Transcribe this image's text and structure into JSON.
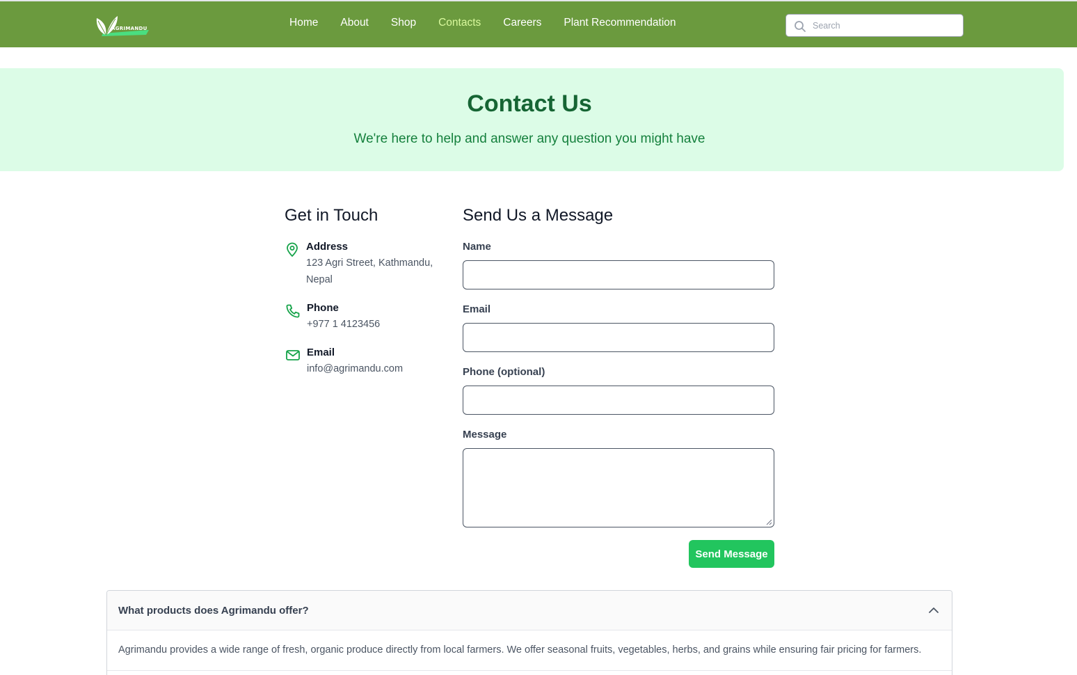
{
  "header": {
    "logo_text": "AGRIMANDU",
    "nav": [
      {
        "label": "Home",
        "active": false
      },
      {
        "label": "About",
        "active": false
      },
      {
        "label": "Shop",
        "active": false
      },
      {
        "label": "Contacts",
        "active": true
      },
      {
        "label": "Careers",
        "active": false
      },
      {
        "label": "Plant Recommendation",
        "active": false
      }
    ],
    "search": {
      "placeholder": "Search",
      "value": "",
      "icon": "search-icon"
    }
  },
  "hero": {
    "title": "Contact Us",
    "subtitle": "We're here to help and answer any question you might have"
  },
  "contact_info": {
    "heading": "Get in Touch",
    "items": [
      {
        "icon": "map-pin-icon",
        "title": "Address",
        "value": "123 Agri Street, Kathmandu, Nepal"
      },
      {
        "icon": "phone-icon",
        "title": "Phone",
        "value": "+977 1 4123456"
      },
      {
        "icon": "mail-icon",
        "title": "Email",
        "value": "info@agrimandu.com"
      }
    ]
  },
  "form": {
    "heading": "Send Us a Message",
    "fields": [
      {
        "label": "Name",
        "value": ""
      },
      {
        "label": "Email",
        "value": ""
      },
      {
        "label": "Phone (optional)",
        "value": ""
      },
      {
        "label": "Message",
        "value": ""
      }
    ],
    "submit_label": "Send Message"
  },
  "faq": {
    "items": [
      {
        "question": "What products does Agrimandu offer?",
        "answer": "Agrimandu provides a wide range of fresh, organic produce directly from local farmers. We offer seasonal fruits, vegetables, herbs, and grains while ensuring fair pricing for farmers.",
        "expanded": true,
        "icon": "chevron-up-icon"
      }
    ]
  },
  "colors": {
    "header_bg": "#6b9a3e",
    "active_nav": "#d9f99d",
    "hero_bg": "#dcfce7",
    "hero_title": "#166534",
    "accent_icon": "#16a34a",
    "button": "#22c55e"
  }
}
